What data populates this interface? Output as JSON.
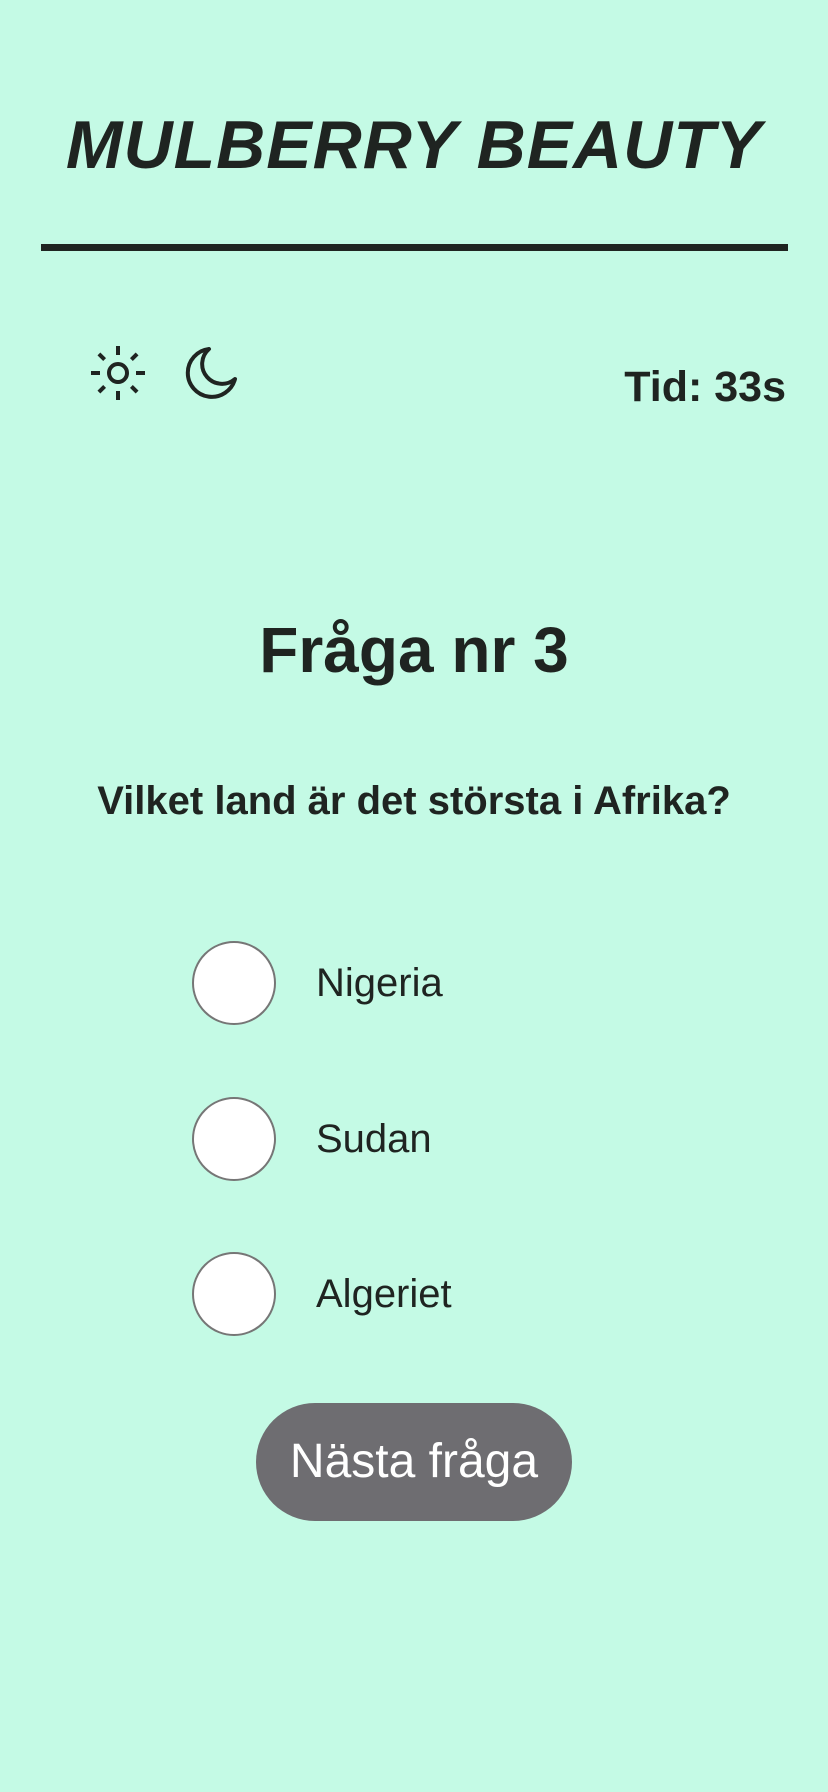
{
  "header": {
    "brand": "MULBERRY BEAUTY"
  },
  "toolbar": {
    "light_theme_icon": "sun-icon",
    "dark_theme_icon": "moon-icon",
    "timer_text": "Tid: 33s"
  },
  "quiz": {
    "question_number": "Fråga nr 3",
    "question_text": "Vilket land är det största i Afrika?",
    "options": [
      {
        "label": "Nigeria",
        "selected": false
      },
      {
        "label": "Sudan",
        "selected": false
      },
      {
        "label": "Algeriet",
        "selected": false
      }
    ],
    "next_button_label": "Nästa fråga"
  },
  "colors": {
    "background": "#c4fae5",
    "text": "#1f2421",
    "button": "#6e6d71",
    "button_text": "#ffffff",
    "radio_fill": "#ffffff",
    "radio_border": "#767676"
  }
}
